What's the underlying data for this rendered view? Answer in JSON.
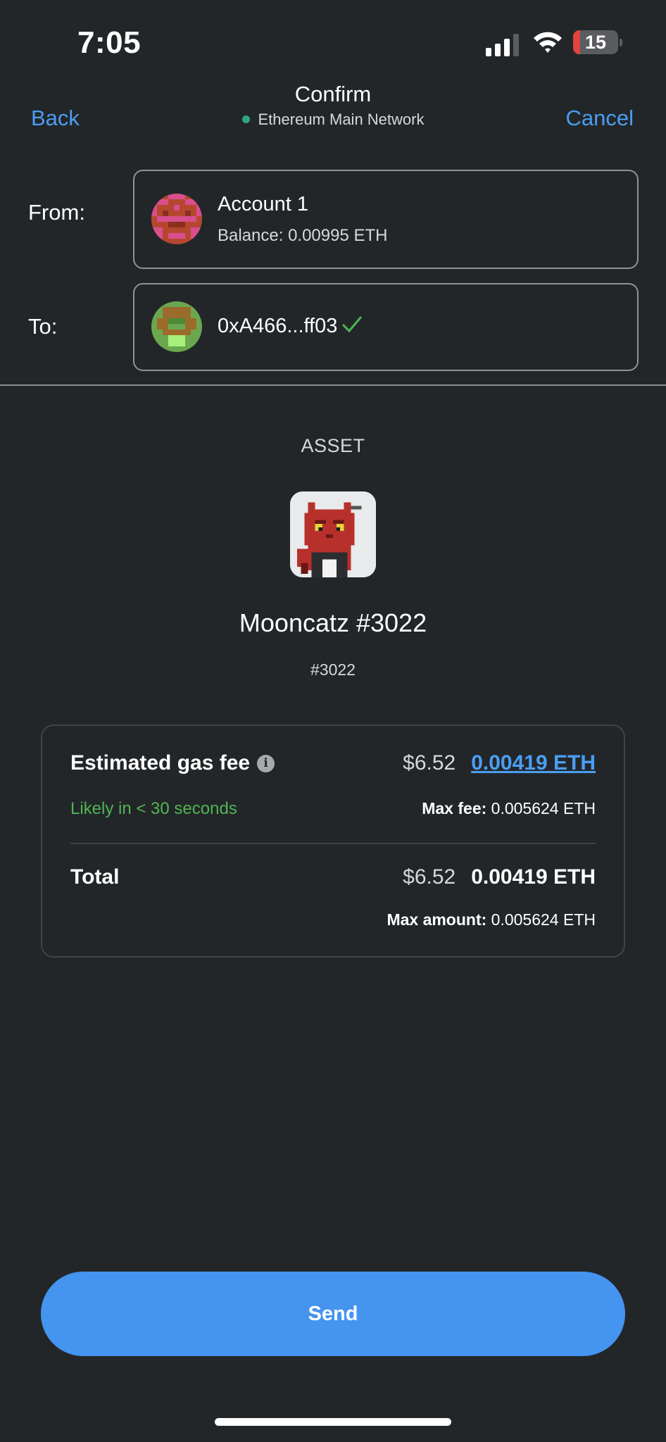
{
  "status": {
    "time": "7:05",
    "battery_percent": "15",
    "battery_level": 0.15,
    "icons": [
      "cellular-signal-icon",
      "wifi-icon",
      "battery-icon"
    ]
  },
  "header": {
    "back_label": "Back",
    "title": "Confirm",
    "network": "Ethereum Main Network",
    "cancel_label": "Cancel"
  },
  "from": {
    "label": "From:",
    "account_name": "Account 1",
    "balance": "Balance: 0.00995 ETH"
  },
  "to": {
    "label": "To:",
    "address": "0xA466...ff03"
  },
  "asset": {
    "section_label": "ASSET",
    "name": "Mooncatz #3022",
    "token_id": "#3022"
  },
  "fees": {
    "gas_label": "Estimated gas fee",
    "gas_usd": "$6.52",
    "gas_eth": "0.00419 ETH",
    "likely": "Likely in < 30 seconds",
    "max_fee_label": "Max fee:",
    "max_fee_value": "0.005624 ETH",
    "total_label": "Total",
    "total_usd": "$6.52",
    "total_eth": "0.00419 ETH",
    "max_amount_label": "Max amount:",
    "max_amount_value": "0.005624 ETH"
  },
  "send_label": "Send",
  "colors": {
    "background": "#232629",
    "accent": "#4a9ef3",
    "button": "#4494f0",
    "success": "#4fb553",
    "network_dot": "#2ea87b"
  }
}
